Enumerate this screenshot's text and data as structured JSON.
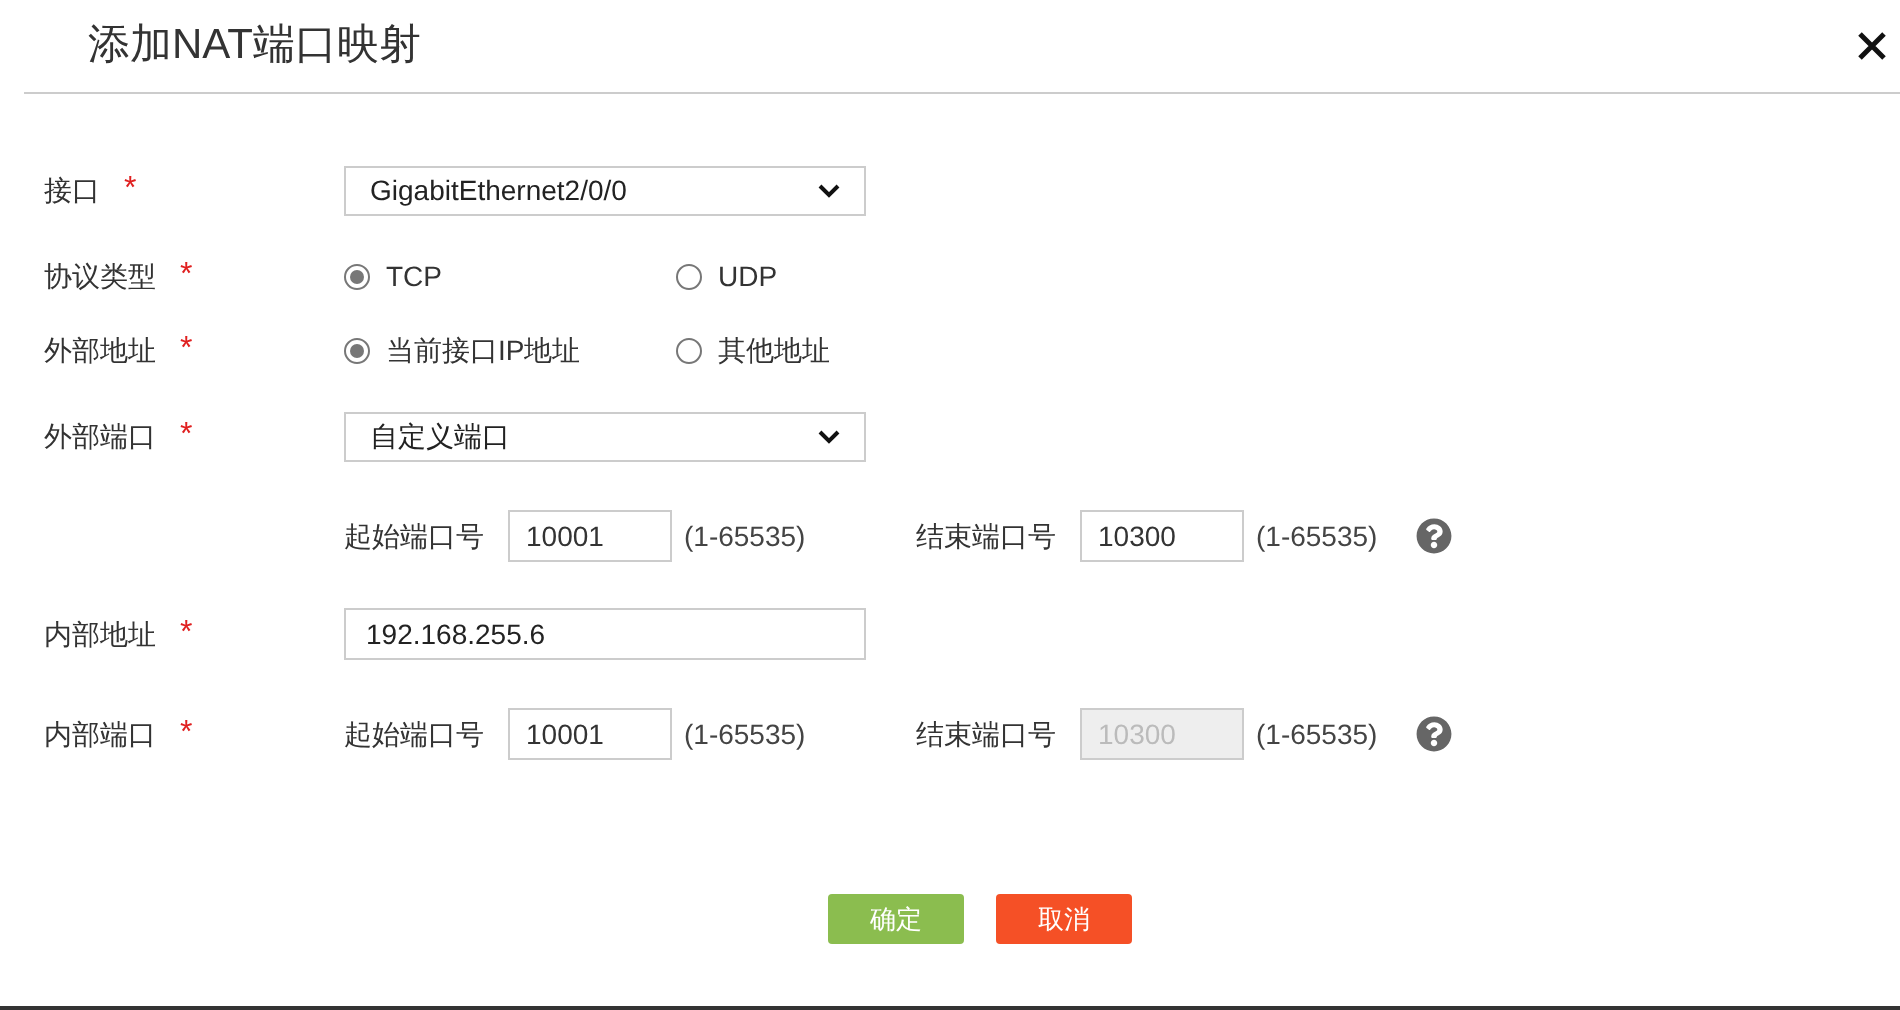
{
  "title": "添加NAT端口映射",
  "rows": [
    {
      "kind": "select",
      "label": "接口",
      "required_mark": "*",
      "value": "GigabitEthernet2/0/0"
    },
    {
      "kind": "radio",
      "label": "协议类型",
      "required_mark": "*",
      "options": [
        {
          "label": "TCP",
          "selected": true
        },
        {
          "label": "UDP",
          "selected": false
        }
      ]
    },
    {
      "kind": "radio",
      "label": "外部地址",
      "required_mark": "*",
      "options": [
        {
          "label": "当前接口IP地址",
          "selected": true
        },
        {
          "label": "其他地址",
          "selected": false
        }
      ]
    },
    {
      "kind": "select",
      "label": "外部端口",
      "required_mark": "*",
      "value": "自定义端口"
    },
    {
      "kind": "port_range",
      "start": {
        "label": "起始端口号",
        "value": "10001",
        "hint": "(1-65535)",
        "disabled": false
      },
      "end": {
        "label": "结束端口号",
        "value": "10300",
        "hint": "(1-65535)",
        "disabled": false
      }
    },
    {
      "kind": "text",
      "label": "内部地址",
      "required_mark": "*",
      "value": "192.168.255.6"
    },
    {
      "kind": "port_range",
      "label": "内部端口",
      "required_mark": "*",
      "start": {
        "label": "起始端口号",
        "value": "10001",
        "hint": "(1-65535)",
        "disabled": false
      },
      "end": {
        "label": "结束端口号",
        "value": "10300",
        "hint": "(1-65535)",
        "disabled": true
      }
    }
  ],
  "buttons": [
    {
      "label": "确定",
      "kind": "primary"
    },
    {
      "label": "取消",
      "kind": "danger"
    }
  ]
}
